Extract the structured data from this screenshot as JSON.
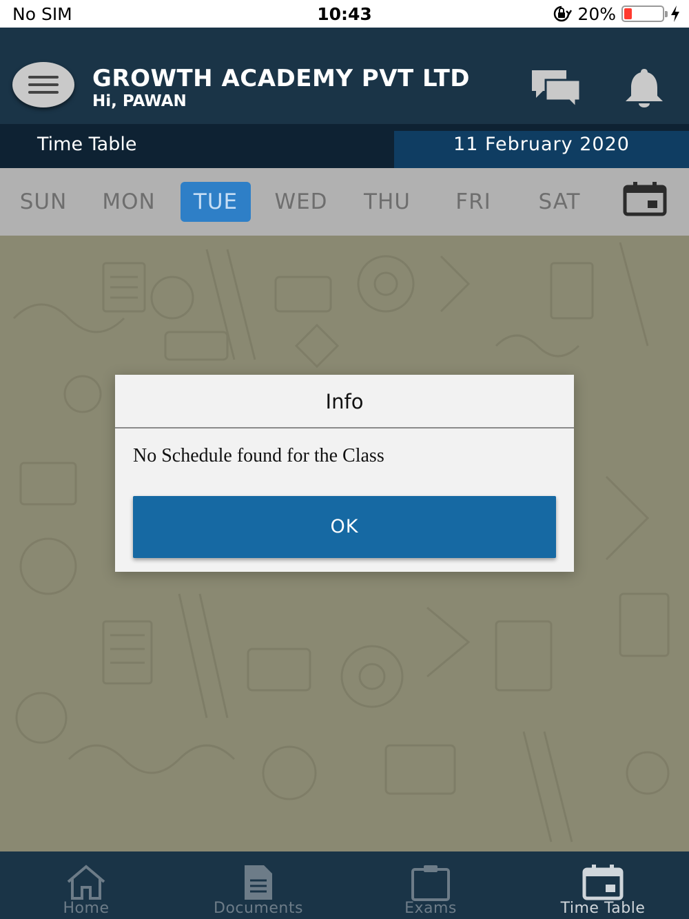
{
  "status_bar": {
    "carrier": "No SIM",
    "time": "10:43",
    "battery_percent": "20%",
    "battery_level": 0.2,
    "battery_color": "#ff3b30",
    "icons": [
      "orientation-lock-icon",
      "battery-icon",
      "charging-bolt-icon"
    ]
  },
  "header": {
    "org_name": "GROWTH ACADEMY PVT LTD",
    "greeting": "Hi, PAWAN",
    "icons": [
      "menu-icon",
      "chat-icon",
      "bell-icon"
    ]
  },
  "sub_header": {
    "title": "Time Table",
    "date": "11 February 2020"
  },
  "days": [
    {
      "label": "SUN",
      "active": false
    },
    {
      "label": "MON",
      "active": false
    },
    {
      "label": "TUE",
      "active": true
    },
    {
      "label": "WED",
      "active": false
    },
    {
      "label": "THU",
      "active": false
    },
    {
      "label": "FRI",
      "active": false
    },
    {
      "label": "SAT",
      "active": false
    }
  ],
  "dialog": {
    "title": "Info",
    "message": "No Schedule found for the Class",
    "ok_label": "OK"
  },
  "bottom_nav": [
    {
      "label": "Home",
      "icon": "home-icon",
      "active": false
    },
    {
      "label": "Documents",
      "icon": "document-icon",
      "active": false
    },
    {
      "label": "Exams",
      "icon": "clipboard-icon",
      "active": false
    },
    {
      "label": "Time Table",
      "icon": "calendar-icon",
      "active": true
    }
  ],
  "colors": {
    "header_bg": "#1a3447",
    "subheader_bg": "#0e2233",
    "date_bg": "#0f3d62",
    "active_day": "#2e7fc7",
    "ok_button": "#1669a3",
    "overlay_bg": "#8a8972"
  }
}
